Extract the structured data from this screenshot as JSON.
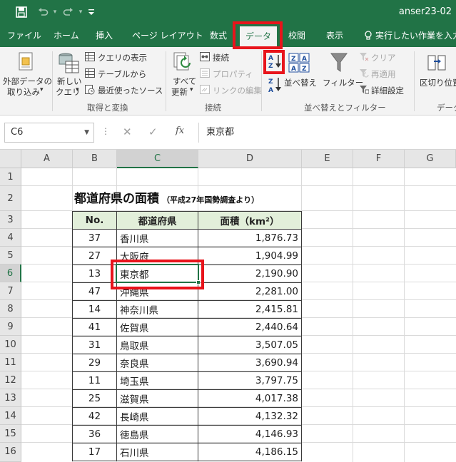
{
  "window": {
    "doc_title": "anser23-02",
    "quick_access": [
      {
        "name": "save-icon",
        "glyph": "💾"
      },
      {
        "name": "undo-icon",
        "glyph": "↶"
      },
      {
        "name": "redo-icon",
        "glyph": "↷"
      },
      {
        "name": "customize-qat-icon",
        "glyph": "▾"
      }
    ]
  },
  "tabs": [
    {
      "label": "ファイル"
    },
    {
      "label": "ホーム"
    },
    {
      "label": "挿入"
    },
    {
      "label": "ページ レイアウト"
    },
    {
      "label": "数式"
    },
    {
      "label": "データ",
      "active": true
    },
    {
      "label": "校閲"
    },
    {
      "label": "表示"
    }
  ],
  "tell_me": "実行したい作業を入力し",
  "ribbon": {
    "external_data": {
      "line1": "外部データの",
      "line2": "取り込み",
      "dropdown": "▾"
    },
    "new_query": {
      "line1": "新しい",
      "line2": "クエリ",
      "dropdown": "▾"
    },
    "show_queries": "クエリの表示",
    "from_table": "テーブルから",
    "recent_sources": "最近使ったソース",
    "group_get_transform": "取得と変換",
    "refresh_all": {
      "line1": "すべて",
      "line2": "更新",
      "dropdown": "▾"
    },
    "connections": "接続",
    "properties": "プロパティ",
    "edit_links": "リンクの編集",
    "group_connections": "接続",
    "sort_az_label": "A Z",
    "sort_za_label": "Z A",
    "sort": "並べ替え",
    "filter": "フィルター",
    "clear": "クリア",
    "reapply": "再適用",
    "advanced": "詳細設定",
    "group_sort_filter": "並べ替えとフィルター",
    "text_to_columns": "区切り位置",
    "group_data_partial": "データ"
  },
  "formula_bar": {
    "name_box": "C6",
    "cancel": "✕",
    "enter": "✓",
    "fx": "fx",
    "value": "東京都"
  },
  "grid": {
    "columns": [
      "A",
      "B",
      "C",
      "D",
      "E",
      "F",
      "G"
    ],
    "rows": [
      "1",
      "2",
      "3",
      "4",
      "5",
      "6",
      "7",
      "8",
      "9",
      "10",
      "11",
      "12",
      "13",
      "14",
      "15",
      "16"
    ],
    "title": "都道府県の面積",
    "subtitle": "（平成27年国勢調査より）",
    "headers": {
      "no": "No.",
      "pref": "都道府県",
      "area": "面積（km²）"
    },
    "records": [
      {
        "no": "37",
        "pref": "香川県",
        "area": "1,876.73"
      },
      {
        "no": "27",
        "pref": "大阪府",
        "area": "1,904.99"
      },
      {
        "no": "13",
        "pref": "東京都",
        "area": "2,190.90"
      },
      {
        "no": "47",
        "pref": "沖縄県",
        "area": "2,281.00"
      },
      {
        "no": "14",
        "pref": "神奈川県",
        "area": "2,415.81"
      },
      {
        "no": "41",
        "pref": "佐賀県",
        "area": "2,440.64"
      },
      {
        "no": "31",
        "pref": "鳥取県",
        "area": "3,507.05"
      },
      {
        "no": "29",
        "pref": "奈良県",
        "area": "3,690.94"
      },
      {
        "no": "11",
        "pref": "埼玉県",
        "area": "3,797.75"
      },
      {
        "no": "25",
        "pref": "滋賀県",
        "area": "4,017.38"
      },
      {
        "no": "42",
        "pref": "長崎県",
        "area": "4,132.32"
      },
      {
        "no": "36",
        "pref": "徳島県",
        "area": "4,146.93"
      },
      {
        "no": "17",
        "pref": "石川県",
        "area": "4,186.15"
      }
    ]
  },
  "colors": {
    "excel_green": "#217346",
    "highlight_red": "#e8141b",
    "header_fill": "#e2efda"
  }
}
